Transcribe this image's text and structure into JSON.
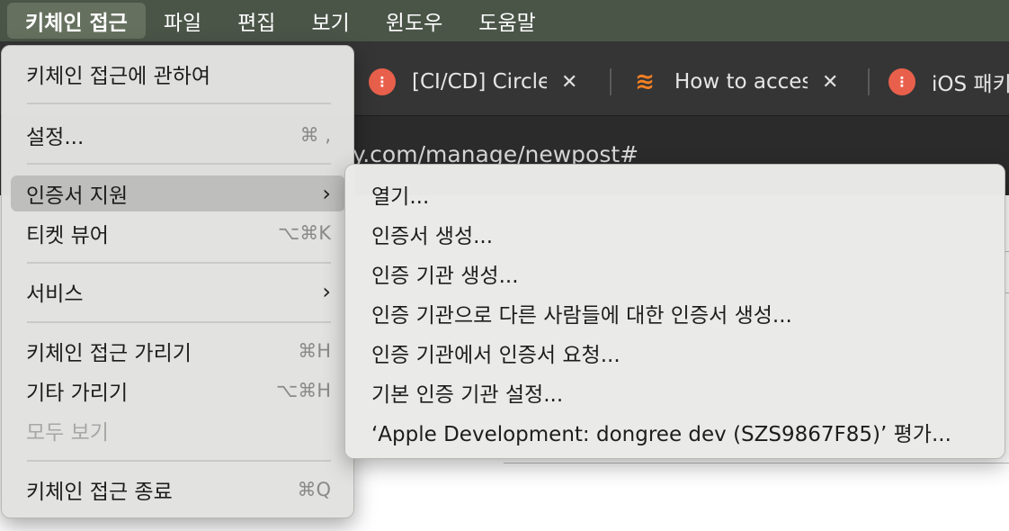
{
  "menubar": {
    "app": "키체인 접근",
    "items": [
      "파일",
      "편집",
      "보기",
      "윈도우",
      "도움말"
    ]
  },
  "browser": {
    "tabs": [
      {
        "title": "[CI/CD] Circle",
        "icon": "tistory-icon"
      },
      {
        "title": "How to acces",
        "icon": "stackoverflow-icon"
      },
      {
        "title": "iOS 패키",
        "icon": "tistory-icon"
      }
    ],
    "url": "y.com/manage/newpost#"
  },
  "app_menu": {
    "about": "키체인 접근에 관하여",
    "settings": {
      "label": "설정...",
      "shortcut": "⌘ ,"
    },
    "cert_assistant": {
      "label": "인증서 지원",
      "chevron": "›"
    },
    "ticket_viewer": {
      "label": "티켓 뷰어",
      "shortcut": "⌥⌘K"
    },
    "services": {
      "label": "서비스",
      "chevron": "›"
    },
    "hide": {
      "label": "키체인 접근 가리기",
      "shortcut": "⌘H"
    },
    "hide_others": {
      "label": "기타 가리기",
      "shortcut": "⌥⌘H"
    },
    "show_all": "모두 보기",
    "quit": {
      "label": "키체인 접근 종료",
      "shortcut": "⌘Q"
    }
  },
  "submenu": {
    "items": [
      "열기...",
      "인증서 생성...",
      "인증 기관 생성...",
      "인증 기관으로 다른 사람들에 대한 인증서 생성...",
      "인증 기관에서 인증서 요청...",
      "기본 인증 기관 설정...",
      "‘Apple Development: dongree dev (SZS9867F85)’ 평가..."
    ]
  },
  "colors": {
    "menubar_bg": "#4a5548",
    "menu_bg": "#e2e2e0",
    "highlight": "#bebebc",
    "tab_favicon": "#e8604c"
  }
}
